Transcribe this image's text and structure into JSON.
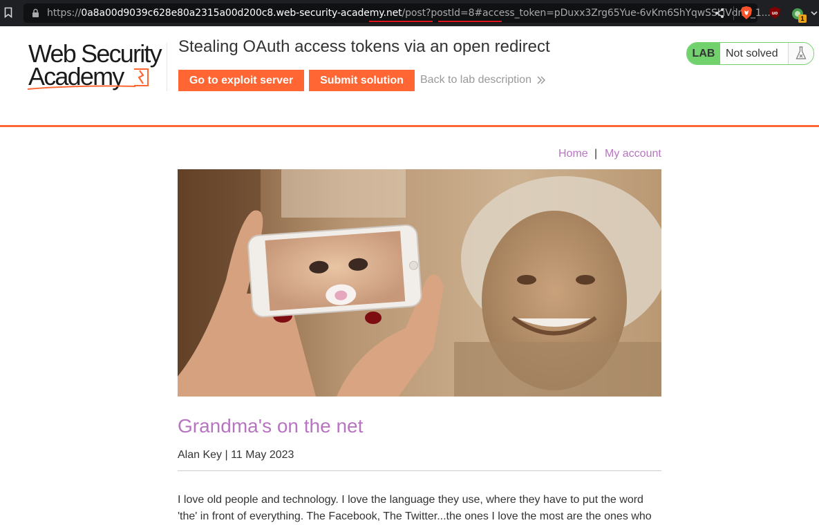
{
  "browser": {
    "url_scheme": "https://",
    "url_host": "0a8a00d9039c628e80a2315a00d200c8.web-security-academy.net",
    "url_path": "/post?postId=8#access_token=pDuxx3Zrg65Yue-6vKm6ShYqwSSLiVdm-_1...",
    "extension_badge": "1"
  },
  "header": {
    "logo_line1": "Web Security",
    "logo_line2": "Academy",
    "lab_title": "Stealing OAuth access tokens via an open redirect",
    "exploit_button": "Go to exploit server",
    "submit_button": "Submit solution",
    "back_link": "Back to lab description",
    "lab_badge": "LAB",
    "lab_status": "Not solved"
  },
  "nav": {
    "home": "Home",
    "separator": "|",
    "my_account": "My account"
  },
  "post": {
    "title": "Grandma's on the net",
    "meta": "Alan Key | 11 May 2023",
    "body": "I love old people and technology. I love the language they use, where they have to put the word 'the' in front of everything. The Facebook, The Twitter...the ones I love the most are the ones who"
  },
  "colors": {
    "accent": "#ff6633",
    "link": "#b774c0",
    "lab_green": "#70d16d",
    "browser_bg": "#1f2023",
    "url_underline": "#e0161f"
  }
}
